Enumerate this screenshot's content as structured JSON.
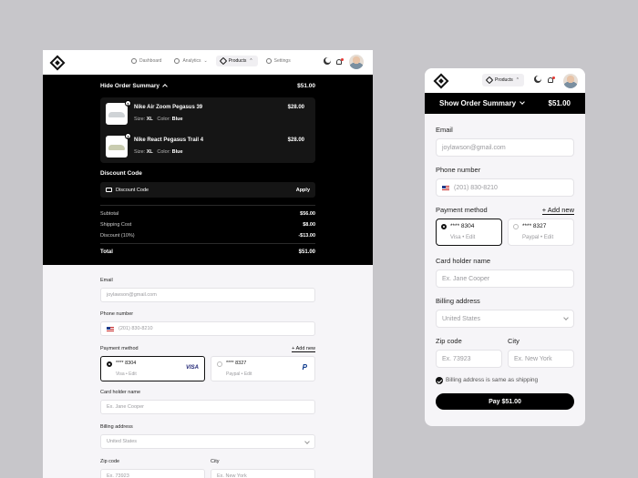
{
  "nav": {
    "dashboard": "Dashboard",
    "analytics": "Analytics",
    "products": "Products",
    "settings": "Settings"
  },
  "summary": {
    "toggle_hide": "Hide Order Summary",
    "toggle_show": "Show Order Summary",
    "total_header": "$51.00",
    "items": [
      {
        "qty": "1",
        "name": "Nike Air Zoom Pegasus 39",
        "size_label": "Size:",
        "size": "XL",
        "color_label": "Color:",
        "color": "Blue",
        "price": "$28.00"
      },
      {
        "qty": "2",
        "name": "Nike React Pegasus Trail 4",
        "size_label": "Size:",
        "size": "XL",
        "color_label": "Color:",
        "color": "Blue",
        "price": "$28.00"
      }
    ],
    "discount_title": "Discount Code",
    "discount_placeholder": "Discount Code",
    "apply": "Apply",
    "rows": [
      {
        "label": "Subtotal",
        "value": "$56.00"
      },
      {
        "label": "Shipping Cost",
        "value": "$8.00"
      },
      {
        "label": "Discount (10%)",
        "value": "-$13.00"
      }
    ],
    "total_label": "Total",
    "total_value": "$51.00"
  },
  "form": {
    "email_label": "Email",
    "email_value": "joylawson@gmail.com",
    "phone_label": "Phone number",
    "phone_value": "(201) 830-8210",
    "payment_label": "Payment method",
    "add_new": "+ Add new",
    "cards": [
      {
        "number": "**** 8304",
        "sub": "Visa  •  Edit",
        "brand": "VISA",
        "selected": true
      },
      {
        "number": "**** 8327",
        "sub": "Paypal  •  Edit",
        "brand": "P",
        "selected": false
      }
    ],
    "holder_label": "Card holder name",
    "holder_placeholder": "Ex. Jane Cooper",
    "billing_label": "Billing address",
    "billing_value": "United States",
    "zip_label": "Zip code",
    "zip_placeholder": "Ex. 73923",
    "city_label": "City",
    "city_placeholder": "Ex. New York",
    "same_billing": "Billing address is same as shipping",
    "pay": "Pay $51.00"
  }
}
